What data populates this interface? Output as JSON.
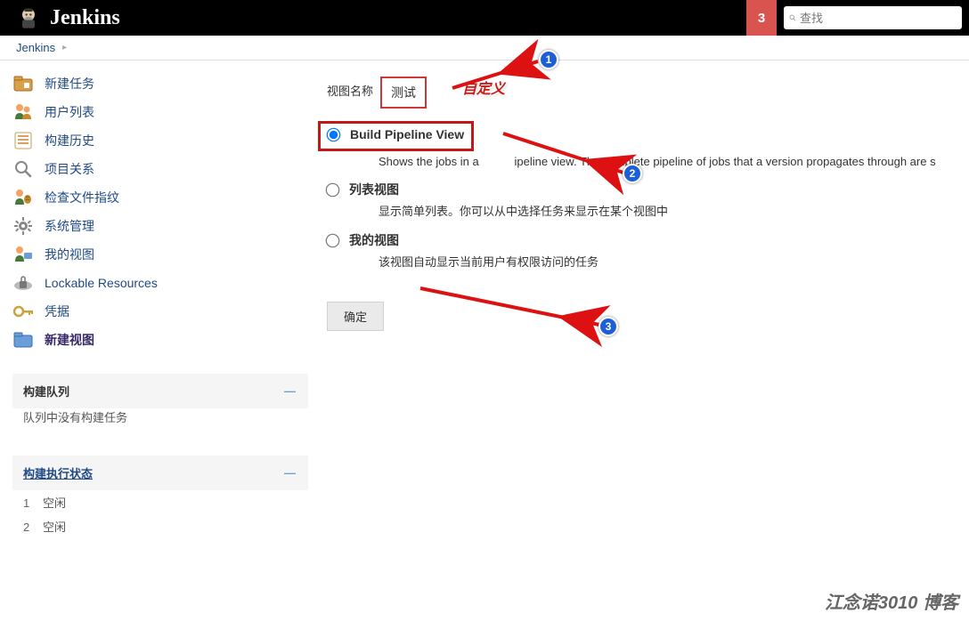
{
  "header": {
    "title": "Jenkins",
    "badge": "3",
    "search_placeholder": "查找"
  },
  "breadcrumb": {
    "root": "Jenkins"
  },
  "sidebar": {
    "nav": [
      {
        "label": "新建任务",
        "icon": "new-task"
      },
      {
        "label": "用户列表",
        "icon": "people"
      },
      {
        "label": "构建历史",
        "icon": "history"
      },
      {
        "label": "项目关系",
        "icon": "search"
      },
      {
        "label": "检查文件指纹",
        "icon": "fingerprint"
      },
      {
        "label": "系统管理",
        "icon": "gear"
      },
      {
        "label": "我的视图",
        "icon": "my-view"
      },
      {
        "label": "Lockable Resources",
        "icon": "lock"
      },
      {
        "label": "凭据",
        "icon": "credentials"
      },
      {
        "label": "新建视图",
        "icon": "new-view",
        "active": true
      }
    ],
    "build_queue": {
      "title": "构建队列",
      "empty_text": "队列中没有构建任务"
    },
    "exec_status": {
      "title": "构建执行状态",
      "executors": [
        {
          "num": "1",
          "state": "空闲"
        },
        {
          "num": "2",
          "state": "空闲"
        }
      ]
    }
  },
  "content": {
    "view_name_label": "视图名称",
    "view_name_value": "测试",
    "custom_annotation": "自定义",
    "options": [
      {
        "label": "Build Pipeline View",
        "desc_prefix": "Shows the jobs in a",
        "desc_mid": "ipeline view. The complete pipeline of jobs that a version propagates through are s",
        "checked": true
      },
      {
        "label": "列表视图",
        "desc": "显示简单列表。你可以从中选择任务来显示在某个视图中",
        "checked": false
      },
      {
        "label": "我的视图",
        "desc": "该视图自动显示当前用户有权限访问的任务",
        "checked": false
      }
    ],
    "confirm_label": "确定"
  },
  "annotations": {
    "badge1": "1",
    "badge2": "2",
    "badge3": "3"
  },
  "watermark": "江念诺3010 博客"
}
